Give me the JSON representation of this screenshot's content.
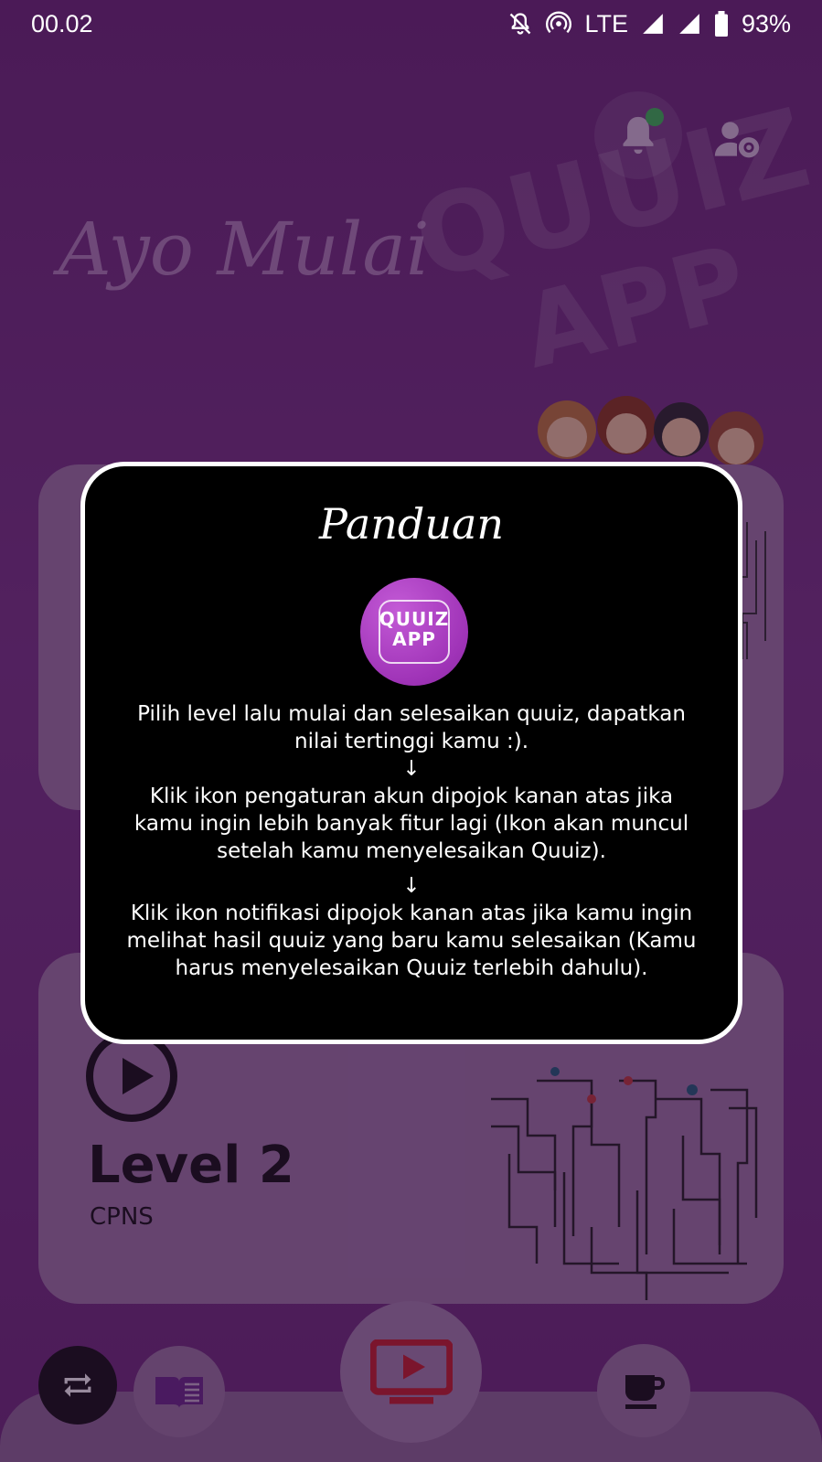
{
  "status_bar": {
    "time": "00.02",
    "network": "LTE",
    "battery": "93%"
  },
  "background": {
    "greeting": "Ayo Mulai",
    "watermark_line1": "QUUIZ",
    "watermark_line2": "APP"
  },
  "cards": [
    {
      "title": "",
      "subtitle": ""
    },
    {
      "title": "Level 2",
      "subtitle": "CPNS"
    }
  ],
  "dialog": {
    "title": "Panduan",
    "logo_line1": "QUUIZ",
    "logo_line2": "APP",
    "paragraph1": "Pilih level lalu mulai dan selesaikan quuiz, dapatkan nilai tertinggi kamu :).",
    "arrow1": "↓",
    "paragraph2": "Klik ikon pengaturan akun dipojok kanan atas jika kamu ingin lebih banyak fitur lagi (Ikon akan muncul setelah kamu menyelesaikan Quuiz).",
    "arrow2": "↓",
    "paragraph3": "Klik ikon notifikasi dipojok kanan atas jika kamu ingin melihat hasil quuiz yang baru kamu selesaikan (Kamu harus menyelesaikan Quuiz terlebih dahulu)."
  },
  "icons": {
    "notification": "bell-icon",
    "account_settings": "user-settings-icon",
    "refresh": "refresh-icon",
    "book": "book-icon",
    "video": "video-play-icon",
    "coffee": "coffee-icon"
  },
  "colors": {
    "background_purple": "#6b2a79",
    "dialog_bg": "#000000",
    "dialog_border": "#ffffff",
    "notif_dot": "#3bbf55",
    "video_red": "#c8202a",
    "book_purple": "#6a2a8a"
  }
}
